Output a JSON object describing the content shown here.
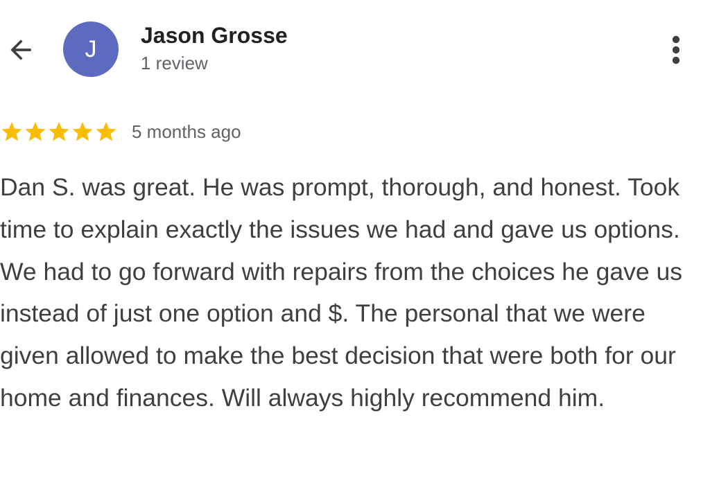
{
  "header": {
    "back_icon": "arrow-back-icon",
    "avatar": {
      "initial": "J",
      "color": "#5c6bc0"
    },
    "reviewer_name": "Jason Grosse",
    "review_count": "1 review",
    "more_icon": "more-vert-icon"
  },
  "review": {
    "rating": 5,
    "max_rating": 5,
    "star_icon": "star-icon",
    "star_color": "#fbbc04",
    "time": "5 months ago",
    "text": "Dan S. was great. He was prompt, thorough, and honest. Took time to explain exactly the issues we had and gave us options. We had to go forward with repairs from the choices he gave us instead of just one option and $. The personal that we were given allowed to make the best decision that were both for our home and finances. Will always highly recommend him."
  }
}
